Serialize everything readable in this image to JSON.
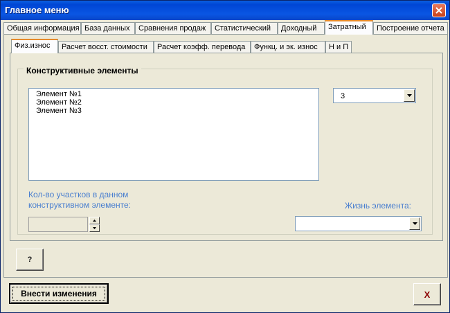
{
  "window": {
    "title": "Главное меню",
    "close_icon": "close-icon"
  },
  "main_tabs": [
    {
      "label": "Общая информация",
      "active": false
    },
    {
      "label": "База данных",
      "active": false
    },
    {
      "label": "Сравнения продаж",
      "active": false
    },
    {
      "label": "Статистический",
      "active": false
    },
    {
      "label": "Доходный",
      "active": false
    },
    {
      "label": "Затратный",
      "active": true
    },
    {
      "label": "Построение отчета",
      "active": false
    }
  ],
  "sub_tabs": [
    {
      "label": "Физ.износ",
      "active": true
    },
    {
      "label": "Расчет восст. стоимости",
      "active": false
    },
    {
      "label": "Расчет коэфф. перевода",
      "active": false
    },
    {
      "label": "Функц. и эк. износ",
      "active": false
    },
    {
      "label": "Н и П",
      "active": false
    }
  ],
  "group": {
    "label": "Конструктивные элементы",
    "elements": [
      "Элемент №1",
      "Элемент №2",
      "Элемент №3"
    ],
    "count_select": {
      "value": "3"
    },
    "sections_label_line1": "Кол-во участков в данном",
    "sections_label_line2": "конструктивном элементе:",
    "sections_value": "",
    "life_label": "Жизнь элемента:",
    "life_select": {
      "value": ""
    }
  },
  "buttons": {
    "help": "?",
    "apply": "Внести изменения",
    "close": "X"
  },
  "colors": {
    "title_bar": "#0a56e3",
    "active_tab_accent": "#e68b2c",
    "blue_label": "#4a7fcf",
    "close_x": "#8b0000"
  }
}
